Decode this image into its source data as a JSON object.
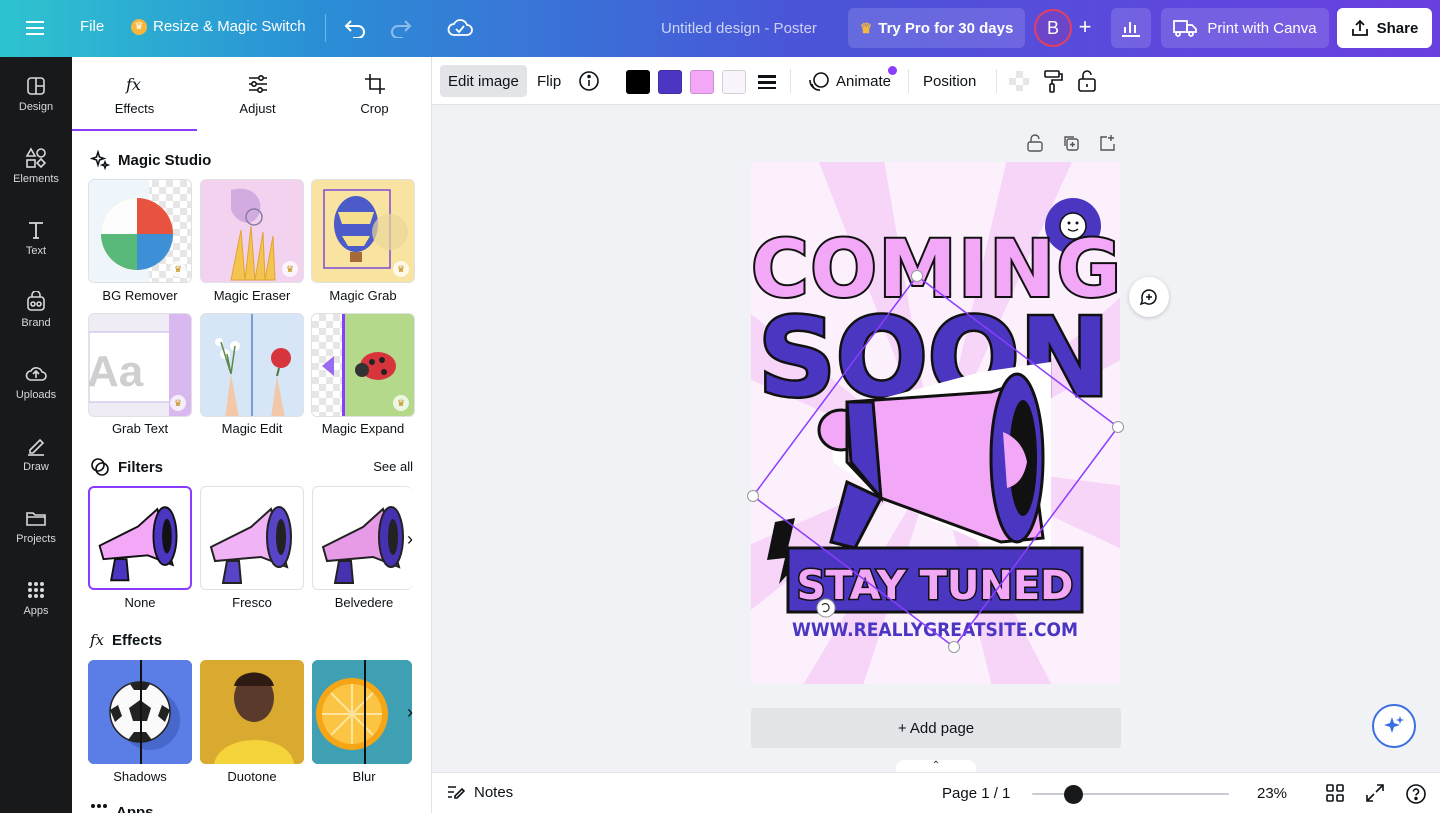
{
  "topbar": {
    "file_label": "File",
    "resize_label": "Resize & Magic Switch",
    "doc_title": "Untitled design - Poster",
    "pro_label": "Try Pro for 30 days",
    "avatar_initial": "B",
    "print_label": "Print with Canva",
    "share_label": "Share"
  },
  "rail": {
    "items": [
      {
        "label": "Design",
        "icon": "design-icon"
      },
      {
        "label": "Elements",
        "icon": "elements-icon"
      },
      {
        "label": "Text",
        "icon": "text-icon"
      },
      {
        "label": "Brand",
        "icon": "brand-icon"
      },
      {
        "label": "Uploads",
        "icon": "uploads-icon"
      },
      {
        "label": "Draw",
        "icon": "draw-icon"
      },
      {
        "label": "Projects",
        "icon": "projects-icon"
      },
      {
        "label": "Apps",
        "icon": "apps-icon"
      }
    ]
  },
  "panel": {
    "tabs": [
      {
        "label": "Effects",
        "icon": "fx-icon",
        "active": true
      },
      {
        "label": "Adjust",
        "icon": "sliders-icon",
        "active": false
      },
      {
        "label": "Crop",
        "icon": "crop-icon",
        "active": false
      }
    ],
    "magic_studio": {
      "title": "Magic Studio",
      "tools": [
        "BG Remover",
        "Magic Eraser",
        "Magic Grab",
        "Grab Text",
        "Magic Edit",
        "Magic Expand"
      ]
    },
    "filters": {
      "title": "Filters",
      "see_all": "See all",
      "items": [
        "None",
        "Fresco",
        "Belvedere"
      ]
    },
    "effects": {
      "title": "Effects",
      "items": [
        "Shadows",
        "Duotone",
        "Blur"
      ]
    },
    "apps_title": "Apps"
  },
  "context_toolbar": {
    "edit_image": "Edit image",
    "flip": "Flip",
    "swatches": [
      "#000000",
      "#4b36c2",
      "#f3a7f7",
      "#faf5fc"
    ],
    "animate": "Animate",
    "position": "Position"
  },
  "poster": {
    "line1": "COMING",
    "line2": "SOON",
    "banner": "STAY TUNED",
    "website": "WWW.REALLYGREATSITE.COM"
  },
  "canvas": {
    "add_page": "+ Add page"
  },
  "bottombar": {
    "notes": "Notes",
    "page_indicator": "Page 1 / 1",
    "zoom_level": "23%",
    "zoom_fraction": 0.23
  },
  "colors": {
    "accent": "#8b3dff",
    "poster_purple": "#4b36c2",
    "poster_pink": "#f3a7f7",
    "rail_bg": "#18191b"
  }
}
